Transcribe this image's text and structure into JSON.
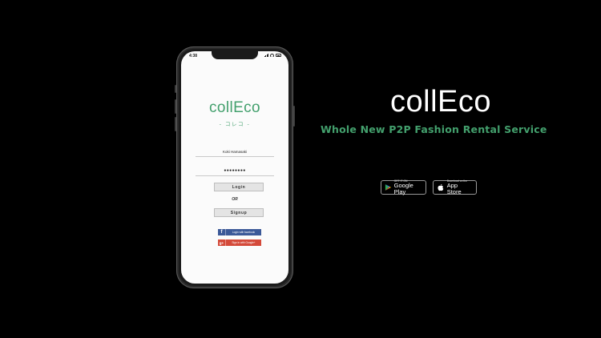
{
  "phone": {
    "status_time": "4:38",
    "app_logo": "collEco",
    "app_subtitle": "- コレコ -",
    "username_value": "Koki Hamasaki",
    "password_value": "●●●●●●●●",
    "login_label": "Login",
    "or_label": "OR",
    "signup_label": "Signup",
    "facebook_icon": "f",
    "facebook_label": "Login with facebook",
    "google_icon": "g+",
    "google_label": "Sign in with Google+"
  },
  "brand": {
    "name": "collEco",
    "tagline": "Whole New P2P Fashion Rental Service"
  },
  "stores": {
    "google_small": "GET IT ON",
    "google_big": "Google Play",
    "apple_small": "Download on the",
    "apple_big": "App Store"
  },
  "colors": {
    "accent_green": "#43a06d",
    "facebook_blue": "#3b5998",
    "google_red": "#d44a3a",
    "background": "#000000"
  }
}
